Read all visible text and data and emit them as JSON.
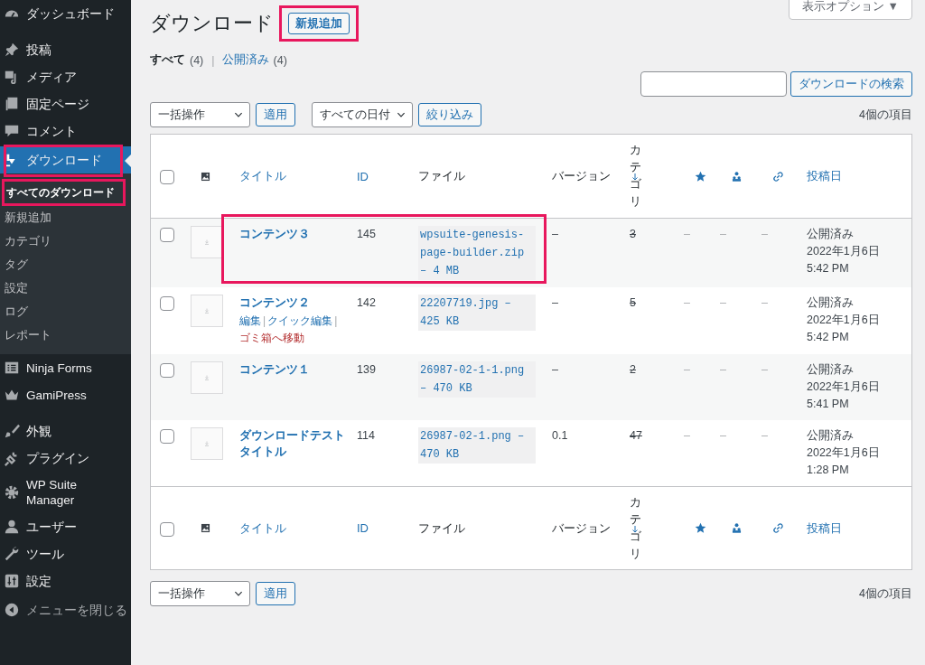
{
  "sidebar": {
    "items": [
      {
        "kind": "item",
        "label": "ダッシュボード",
        "current": false,
        "highlighted": false
      },
      {
        "kind": "separator"
      },
      {
        "kind": "item",
        "label": "投稿",
        "current": false,
        "highlighted": false
      },
      {
        "kind": "item",
        "label": "メディア",
        "current": false,
        "highlighted": false
      },
      {
        "kind": "item",
        "label": "固定ページ",
        "current": false,
        "highlighted": false
      },
      {
        "kind": "item",
        "label": "コメント",
        "current": false,
        "highlighted": false
      },
      {
        "kind": "item",
        "label": "ダウンロード",
        "current": true,
        "highlighted": true,
        "children": [
          {
            "label": "すべてのダウンロード",
            "selected": true,
            "highlighted": true
          },
          {
            "label": "新規追加",
            "selected": false,
            "highlighted": false
          },
          {
            "label": "カテゴリ",
            "selected": false,
            "highlighted": false
          },
          {
            "label": "タグ",
            "selected": false,
            "highlighted": false
          },
          {
            "label": "設定",
            "selected": false,
            "highlighted": false
          },
          {
            "label": "ログ",
            "selected": false,
            "highlighted": false
          },
          {
            "label": "レポート",
            "selected": false,
            "highlighted": false
          }
        ]
      },
      {
        "kind": "item",
        "label": "Ninja Forms",
        "current": false,
        "highlighted": false
      },
      {
        "kind": "item",
        "label": "GamiPress",
        "current": false,
        "highlighted": false
      },
      {
        "kind": "separator"
      },
      {
        "kind": "item",
        "label": "外観",
        "current": false,
        "highlighted": false
      },
      {
        "kind": "item",
        "label": "プラグイン",
        "current": false,
        "highlighted": false
      },
      {
        "kind": "item",
        "label": "WP Suite Manager",
        "current": false,
        "highlighted": false
      },
      {
        "kind": "item",
        "label": "ユーザー",
        "current": false,
        "highlighted": false
      },
      {
        "kind": "item",
        "label": "ツール",
        "current": false,
        "highlighted": false
      },
      {
        "kind": "item",
        "label": "設定",
        "current": false,
        "highlighted": false
      },
      {
        "kind": "collapse",
        "label": "メニューを閉じる"
      }
    ]
  },
  "screen_options": {
    "label": "表示オプション",
    "caret": "▼"
  },
  "page_title": "ダウンロード",
  "add_new": {
    "label": "新規追加",
    "highlighted": true
  },
  "views": [
    {
      "label": "すべて",
      "count": "(4)",
      "selected": true
    },
    {
      "separator": "|",
      "label": "公開済み",
      "count": "(4)",
      "selected": false
    }
  ],
  "search": {
    "button": "ダウンロードの検索"
  },
  "bulk_action": {
    "value": "一括操作",
    "button": "適用"
  },
  "date_filter": {
    "value": "すべての日付",
    "button": "絞り込み"
  },
  "item_count": "4個の項目",
  "table": {
    "columns": [
      {
        "kind": "checkbox",
        "checked": false
      },
      {
        "kind": "icon"
      },
      {
        "kind": "text",
        "label": "タイトル",
        "sortable": true
      },
      {
        "kind": "text",
        "label": "ID",
        "sortable": true
      },
      {
        "kind": "text",
        "label": "ファイル",
        "sortable": false
      },
      {
        "kind": "text",
        "label": "バージョン",
        "sortable": false
      },
      {
        "kind": "vertical",
        "label": "カテゴリ",
        "sortable": true
      },
      {
        "kind": "icon"
      },
      {
        "kind": "icon"
      },
      {
        "kind": "icon"
      },
      {
        "kind": "text",
        "label": "投稿日",
        "sortable": true
      }
    ],
    "footer_columns": [
      {
        "kind": "checkbox",
        "checked": false
      },
      {
        "kind": "icon"
      },
      {
        "kind": "text",
        "label": "タイトル",
        "sortable": true
      },
      {
        "kind": "text",
        "label": "ID",
        "sortable": true
      },
      {
        "kind": "text",
        "label": "ファイル",
        "sortable": false
      },
      {
        "kind": "text",
        "label": "バージョン",
        "sortable": false
      },
      {
        "kind": "vertical",
        "label": "カテゴリ",
        "sortable": true
      },
      {
        "kind": "icon"
      },
      {
        "kind": "icon"
      },
      {
        "kind": "icon"
      },
      {
        "kind": "text",
        "label": "投稿日",
        "sortable": true
      }
    ],
    "rows": [
      {
        "checked": false,
        "highlighted": true,
        "title": "コンテンツ３",
        "id": "145",
        "file": "wpsuite-genesis-page-builder.zip – 4 MB",
        "version": "–",
        "count": "3",
        "col_8": "–",
        "col_9": "–",
        "col_10": "–",
        "status": "公開済み",
        "date": "2022年1月6日",
        "time": "5:42 PM"
      },
      {
        "checked": false,
        "highlighted": false,
        "title": "コンテンツ２",
        "actions": [
          {
            "label": "編集",
            "kind": "normal"
          },
          {
            "separator": "|",
            "label": "クイック編集",
            "kind": "normal"
          },
          {
            "separator": "|",
            "label": "ゴミ箱へ移動",
            "kind": "delete"
          }
        ],
        "id": "142",
        "file": "22207719.jpg – 425 KB",
        "version": "–",
        "count": "5",
        "col_8": "–",
        "col_9": "–",
        "col_10": "–",
        "status": "公開済み",
        "date": "2022年1月6日",
        "time": "5:42 PM"
      },
      {
        "checked": false,
        "highlighted": false,
        "title": "コンテンツ１",
        "id": "139",
        "file": "26987-02-1-1.png – 470 KB",
        "version": "–",
        "count": "2",
        "col_8": "–",
        "col_9": "–",
        "col_10": "–",
        "status": "公開済み",
        "date": "2022年1月6日",
        "time": "5:41 PM"
      },
      {
        "checked": false,
        "highlighted": false,
        "title": "ダウンロードテストタイトル",
        "id": "114",
        "file": "26987-02-1.png – 470 KB",
        "version": "0.1",
        "count": "47",
        "col_8": "–",
        "col_9": "–",
        "col_10": "–",
        "status": "公開済み",
        "date": "2022年1月6日",
        "time": "1:28 PM"
      }
    ]
  },
  "bottom_bulk_action": {
    "value": "一括操作",
    "button": "適用"
  },
  "bottom_item_count": "4個の項目"
}
